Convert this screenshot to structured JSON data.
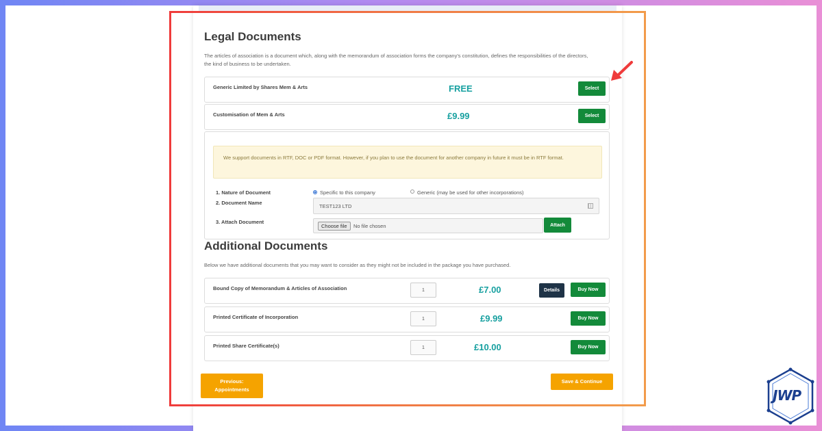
{
  "legal": {
    "title": "Legal Documents",
    "description": "The articles of association is a document which, along with the memorandum of association forms the company's constitution, defines the responsibilities of the directors, the kind of business to be undertaken.",
    "items": [
      {
        "label": "Generic Limited by Shares Mem & Arts",
        "price": "FREE",
        "button": "Select"
      },
      {
        "label": "Customisation of Mem & Arts",
        "price": "£9.99",
        "button": "Select"
      }
    ]
  },
  "upload": {
    "notice": "We support documents in RTF, DOC or PDF format. However, if you plan to use the document for another company in future it must be in RTF format.",
    "nature_label": "1. Nature of Document",
    "option_specific": "Specific to this company",
    "option_generic": "Generic (may be used for other incorporations)",
    "docname_label": "2. Document Name",
    "docname_value": "TEST123 LTD",
    "attach_label": "3. Attach Document",
    "choose_file": "Choose file",
    "no_file": "No file chosen",
    "attach_button": "Attach"
  },
  "additional": {
    "title": "Additional Documents",
    "description": "Below we have additional documents that you may want to consider as they might not be included in the package you have purchased.",
    "details_button": "Details",
    "items": [
      {
        "label": "Bound Copy of Memorandum & Articles of Association",
        "qty": "1",
        "price": "£7.00",
        "button": "Buy Now"
      },
      {
        "label": "Printed Certificate of Incorporation",
        "qty": "1",
        "price": "£9.99",
        "button": "Buy Now"
      },
      {
        "label": "Printed Share Certificate(s)",
        "qty": "1",
        "price": "£10.00",
        "button": "Buy Now"
      }
    ]
  },
  "footer": {
    "previous_line1": "Previous:",
    "previous_line2": "Appointments",
    "save": "Save & Continue"
  },
  "logo": {
    "text": "JWP"
  },
  "colors": {
    "accent_green": "#138a3a",
    "price_teal": "#17a0a0",
    "cta_yellow": "#f5a300",
    "highlight_red": "#ef3b3b"
  }
}
